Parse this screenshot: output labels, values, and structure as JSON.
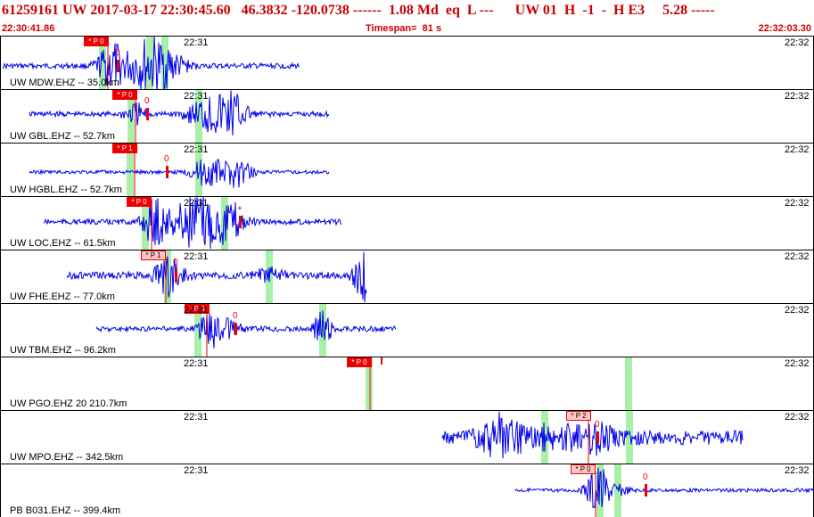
{
  "header": {
    "title": "61259161 UW 2017-03-17 22:30:45.60   46.3832 -120.0738 ------  1.08 Md  eq  L ---      UW 01  H  -1  -  H E3     5.28 -----",
    "start_time": "22:30:41.86",
    "timespan": "Timespan=  81 s",
    "end_time": "22:32:03.30"
  },
  "time_tick_labels": [
    "22:31",
    "22:32"
  ],
  "colors": {
    "trace": "#0000ee",
    "pick_flag": "#ee0000",
    "pick_flag_light": "#ffc8c8",
    "window_band": "#a8f0a8",
    "header_text": "#cc0000"
  },
  "traces": [
    {
      "station_label": "UW MDW.EHZ -- 35.0km",
      "pick_label": "* P 0",
      "pick_style": "solid",
      "mark_label": "0"
    },
    {
      "station_label": "UW GBL.EHZ -- 52.7km",
      "pick_label": "* P 0",
      "pick_style": "solid",
      "mark_label": "0"
    },
    {
      "station_label": "UW HGBL.EHZ -- 52.7km",
      "pick_label": "* P 1",
      "pick_style": "solid",
      "mark_label": "0"
    },
    {
      "station_label": "UW LOC.EHZ -- 61.5km",
      "pick_label": "* P 0",
      "pick_style": "solid",
      "mark_label": "+"
    },
    {
      "station_label": "UW FHE.EHZ -- 77.0km",
      "pick_label": "* P 1",
      "pick_style": "light",
      "mark_label": "0"
    },
    {
      "station_label": "UW TBM.EHZ -- 96.2km",
      "pick_label": "* P 0",
      "pick_style": "solid",
      "mark_label": "0"
    },
    {
      "station_label": "UW PGO.EHZ 20 210.7km",
      "pick_label": "* P 0",
      "pick_style": "solid",
      "mark_label": ""
    },
    {
      "station_label": "UW MPO.EHZ -- 342.5km",
      "pick_label": "* P 2",
      "pick_style": "light",
      "mark_label": "0"
    },
    {
      "station_label": "PB B031.EHZ -- 399.4km",
      "pick_label": "* P 0",
      "pick_style": "light",
      "mark_label": "0"
    }
  ]
}
